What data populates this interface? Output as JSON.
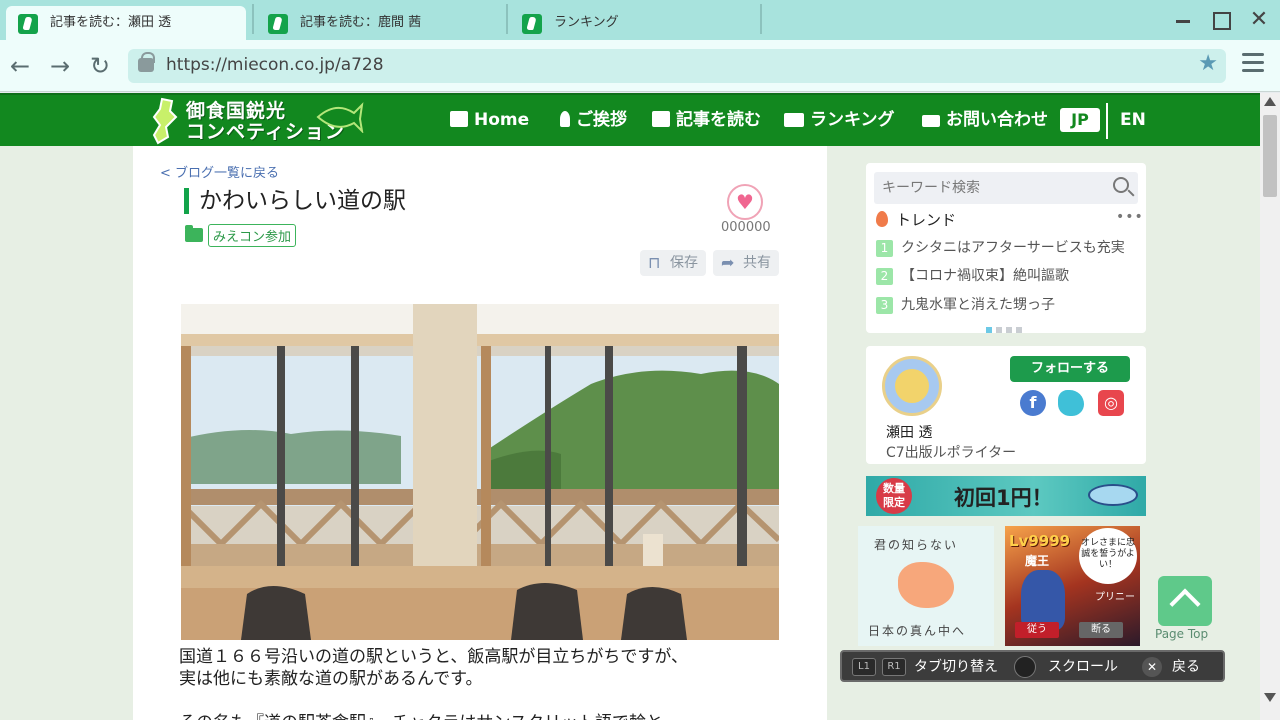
{
  "browser": {
    "tabs": [
      {
        "label": "記事を読む：瀬田 透"
      },
      {
        "label": "記事を読む：鹿間 茜"
      },
      {
        "label": "ランキング"
      }
    ],
    "url": "https://miecon.co.jp/a728"
  },
  "site": {
    "logo_line1": "御食国鋭光",
    "logo_line2": "コンペティション",
    "nav": [
      {
        "label": "Home",
        "icon": "home-icon"
      },
      {
        "label": "ご挨拶",
        "icon": "person-icon"
      },
      {
        "label": "記事を読む",
        "icon": "book-icon"
      },
      {
        "label": "ランキング",
        "icon": "crown-icon"
      },
      {
        "label": "お問い合わせ",
        "icon": "mail-icon"
      }
    ],
    "lang_jp": "JP",
    "lang_en": "EN"
  },
  "article": {
    "back_link": "<  ブログ一覧に戻る",
    "title": "かわいらしい道の駅",
    "category": "みえコン参加",
    "like_count": "000000",
    "save_label": "保存",
    "share_label": "共有",
    "body_line1": "国道１６６号沿いの道の駅というと、飯高駅が目立ちがちですが、",
    "body_line2": "実は他にも素敵な道の駅があるんです。",
    "body_line3": "その名も『道の駅茶倉駅』。チャクラはサンスクリット語で輪と"
  },
  "sidebar": {
    "search_placeholder": "キーワード検索",
    "trend_label": "トレンド",
    "trend_items": [
      {
        "num": "1",
        "text": "クシタニはアフターサービスも充実"
      },
      {
        "num": "2",
        "text": "【コロナ禍収束】絶叫謳歌"
      },
      {
        "num": "3",
        "text": "九鬼水軍と消えた甥っ子"
      }
    ],
    "author_name": "瀬田 透",
    "author_role": "C7出版ルポライター",
    "follow_label": "フォローする"
  },
  "ads": {
    "badge_line1": "数量",
    "badge_line2": "限定",
    "banner_text": "初回1円！",
    "map_line1": "君の知らない",
    "map_line2": "日本の真ん中へ",
    "game_lv": "Lv9999",
    "game_maou": "魔王",
    "game_speech": "オレさまに忠誠を誓うがよい！",
    "game_brand": "プリニー",
    "game_btn1": "従う",
    "game_btn2": "断る"
  },
  "pagetop_label": "Page Top",
  "controls": {
    "l1": "L1",
    "r1": "R1",
    "tab_switch": "タブ切り替え",
    "scroll": "スクロール",
    "back": "戻る"
  }
}
